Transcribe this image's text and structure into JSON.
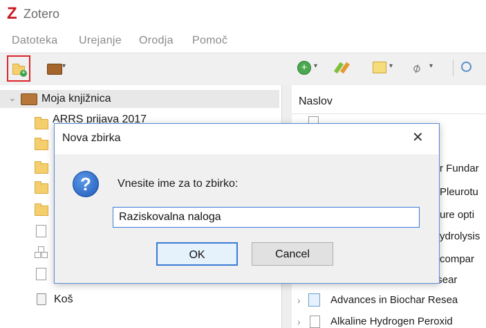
{
  "app": {
    "logo_letter": "Z",
    "title": "Zotero"
  },
  "menu": {
    "items": [
      "Datoteka",
      "Urejanje",
      "Orodja",
      "Pomoč"
    ]
  },
  "toolbar": {
    "left_icons": [
      "new-collection-icon",
      "new-library-icon"
    ],
    "right_icons": [
      "new-item-icon",
      "add-by-identifier-icon",
      "new-note-icon",
      "attachment-icon",
      "search-icon"
    ],
    "highlight_color": "#d9262c"
  },
  "library": {
    "root": "Moja knjižnica",
    "collections": [
      "ARRS prijava 2017",
      "",
      "",
      "",
      ""
    ],
    "trash": "Koš"
  },
  "items_pane": {
    "column_title": "Naslov",
    "visible_fragments": [
      "r Fundar",
      "Pleurotu",
      "ure opti",
      "ydrolysis",
      "compar",
      "Advances in Biochar resear"
    ],
    "rows": [
      "Advances in Biochar Resea",
      "Alkaline Hydrogen Peroxid"
    ]
  },
  "dialog": {
    "title": "Nova zbirka",
    "close_glyph": "✕",
    "prompt": "Vnesite ime za to zbirko:",
    "input_value": "Raziskovalna naloga",
    "ok_label": "OK",
    "cancel_label": "Cancel",
    "question_glyph": "?"
  }
}
